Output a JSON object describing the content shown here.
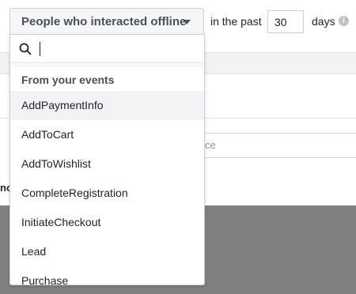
{
  "filter": {
    "audience_label": "People who interacted offline",
    "in_the_past_label": "in the past",
    "days_value": "30",
    "days_label": "days",
    "info_glyph": "i"
  },
  "background": {
    "input_placeholder_fragment": "ce",
    "partial_button_fragment": "no"
  },
  "menu": {
    "search_placeholder": "",
    "section_title": "From your events",
    "items": [
      {
        "label": "AddPaymentInfo",
        "highlighted": true
      },
      {
        "label": "AddToCart",
        "highlighted": false
      },
      {
        "label": "AddToWishlist",
        "highlighted": false
      },
      {
        "label": "CompleteRegistration",
        "highlighted": false
      },
      {
        "label": "InitiateCheckout",
        "highlighted": false
      },
      {
        "label": "Lead",
        "highlighted": false
      },
      {
        "label": "Purchase",
        "highlighted": false
      }
    ]
  },
  "colors": {
    "text": "#1d2129",
    "muted": "#4b4f56",
    "border": "#ccd0d5",
    "highlight": "#f2f3f5",
    "overlay": "#808080"
  }
}
